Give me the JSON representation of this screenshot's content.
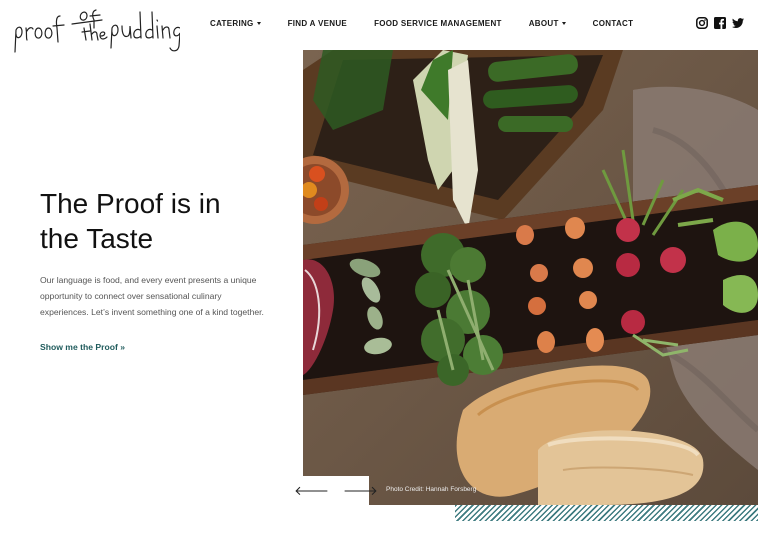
{
  "brand": {
    "logo_text": "proof of the pudding"
  },
  "nav": {
    "items": [
      {
        "label": "CATERING",
        "dropdown": true
      },
      {
        "label": "FIND A VENUE",
        "dropdown": false
      },
      {
        "label": "FOOD SERVICE MANAGEMENT",
        "dropdown": false
      },
      {
        "label": "ABOUT",
        "dropdown": true
      },
      {
        "label": "CONTACT",
        "dropdown": false
      }
    ]
  },
  "social": {
    "icons": [
      "instagram-icon",
      "facebook-icon",
      "twitter-icon"
    ]
  },
  "hero": {
    "title": "The Proof is in the Taste",
    "body": "Our language is food, and every event presents a unique opportunity to connect over sensational culinary experiences. Let’s invent something one of a kind together.",
    "link": "Show me the Proof »"
  },
  "slider": {
    "prev_glyph": "🡐",
    "next_glyph": "🡒",
    "credit": "Photo Credit: Hannah Forsberg"
  },
  "colors": {
    "accent": "#1f5b5c",
    "hatch": "#3e7b80"
  }
}
